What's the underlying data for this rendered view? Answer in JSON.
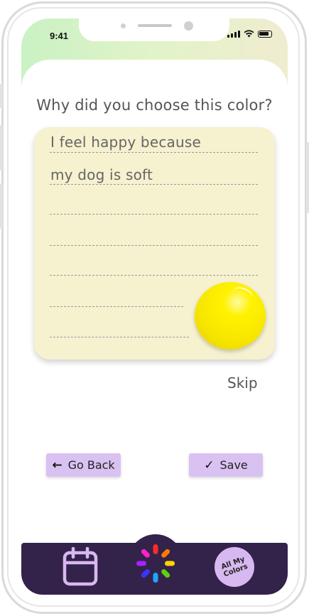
{
  "status_bar": {
    "time": "9:41"
  },
  "screen": {
    "question": "Why did you choose this color?",
    "note_lines": [
      "I feel happy because",
      "my dog is soft"
    ],
    "selected_color": "#fff200",
    "skip_label": "Skip"
  },
  "actions": {
    "back_label": "Go Back",
    "save_label": "Save"
  },
  "bottom_nav": {
    "all_colors_label": "All My Colors",
    "accent_color": "#33224a",
    "button_color": "#d9c2f2"
  }
}
